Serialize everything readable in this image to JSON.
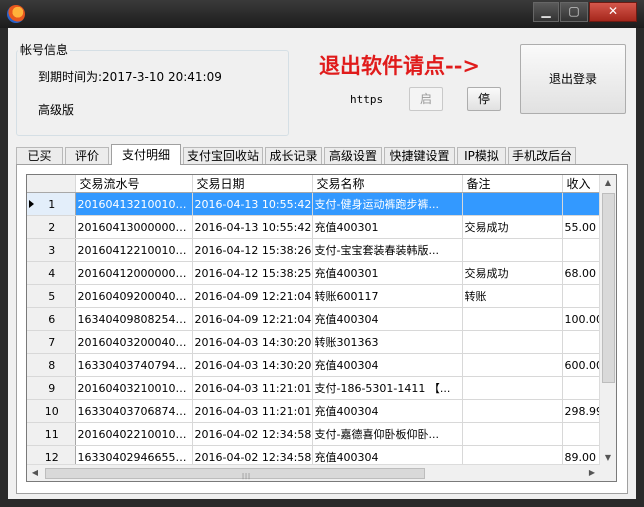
{
  "window": {
    "minimize_glyph": "▁",
    "maximize_glyph": "▢",
    "close_glyph": "✕"
  },
  "account_group": {
    "title": "帐号信息",
    "expiry": "到期时间为:2017-3-10 20:41:09",
    "level": "高级版"
  },
  "exit_hint": "退出软件请点-->",
  "proxy": {
    "protocol": "https",
    "start_label": "启",
    "stop_label": "停"
  },
  "logout_label": "退出登录",
  "tabs": [
    {
      "label": "已买"
    },
    {
      "label": "评价"
    },
    {
      "label": "支付明细",
      "active": true
    },
    {
      "label": "支付宝回收站"
    },
    {
      "label": "成长记录"
    },
    {
      "label": "高级设置"
    },
    {
      "label": "快捷键设置"
    },
    {
      "label": "IP模拟"
    },
    {
      "label": "手机改后台"
    }
  ],
  "grid": {
    "columns": [
      "交易流水号",
      "交易日期",
      "交易名称",
      "备注",
      "收入"
    ],
    "rows": [
      {
        "no": "1",
        "serial": "2016041321001001...",
        "date": "2016-04-13 10:55:42",
        "name": "支付-健身运动裤跑步裤...",
        "note": "",
        "income": ""
      },
      {
        "no": "2",
        "serial": "2016041300000000...",
        "date": "2016-04-13 10:55:42",
        "name": "充值400301",
        "note": "交易成功",
        "income": "55.00"
      },
      {
        "no": "3",
        "serial": "2016041221001001...",
        "date": "2016-04-12 15:38:26",
        "name": "支付-宝宝套装春装韩版...",
        "note": "",
        "income": ""
      },
      {
        "no": "4",
        "serial": "2016041200000000...",
        "date": "2016-04-12 15:38:25",
        "name": "充值400301",
        "note": "交易成功",
        "income": "68.00"
      },
      {
        "no": "5",
        "serial": "2016040920004001...",
        "date": "2016-04-09 12:21:04",
        "name": "转账600117",
        "note": "转账",
        "income": ""
      },
      {
        "no": "6",
        "serial": "163404098082547*...",
        "date": "2016-04-09 12:21:04",
        "name": "充值400304",
        "note": "",
        "income": "100.00"
      },
      {
        "no": "7",
        "serial": "2016040320004001...",
        "date": "2016-04-03 14:30:20",
        "name": "转账301363",
        "note": "",
        "income": ""
      },
      {
        "no": "8",
        "serial": "163304037407947*...",
        "date": "2016-04-03 14:30:20",
        "name": "充值400304",
        "note": "",
        "income": "600.00"
      },
      {
        "no": "9",
        "serial": "2016040321001001...",
        "date": "2016-04-03 11:21:01",
        "name": "支付-186-5301-1411 【...",
        "note": "",
        "income": ""
      },
      {
        "no": "10",
        "serial": "163304037068740*...",
        "date": "2016-04-03 11:21:01",
        "name": "充值400304",
        "note": "",
        "income": "298.99"
      },
      {
        "no": "11",
        "serial": "2016040221001001...",
        "date": "2016-04-02 12:34:58",
        "name": "支付-嘉德喜仰卧板仰卧...",
        "note": "",
        "income": ""
      },
      {
        "no": "12",
        "serial": "163304029466559*...",
        "date": "2016-04-02 12:34:58",
        "name": "充值400304",
        "note": "",
        "income": "89.00"
      }
    ]
  }
}
